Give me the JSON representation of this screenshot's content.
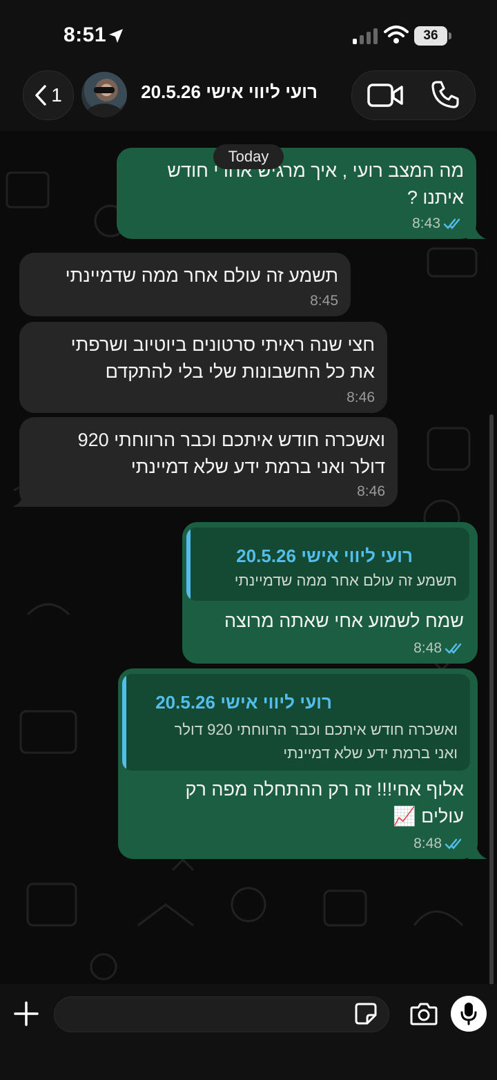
{
  "status_bar": {
    "time": "8:51",
    "battery": "36"
  },
  "header": {
    "back_count": "1",
    "contact_name": "רועי ליווי אישי 20.5.26"
  },
  "date_divider": "Today",
  "messages": [
    {
      "dir": "out",
      "text": "מה המצב רועי , איך מרגיש אחרי חודש\nאיתנו ?",
      "time": "8:43"
    },
    {
      "dir": "in",
      "text": "תשמע זה עולם אחר ממה שדמיינתי",
      "time": "8:45"
    },
    {
      "dir": "in",
      "text": "חצי שנה ראיתי סרטונים ביוטיוב ושרפתי\nאת כל החשבונות שלי בלי להתקדם",
      "time": "8:46"
    },
    {
      "dir": "in",
      "text": "ואשכרה חודש איתכם וכבר הרווחתי 920\nדולר  ואני ברמת ידע שלא דמיינתי",
      "time": "8:46"
    },
    {
      "dir": "out",
      "quote_name": "רועי ליווי אישי 20.5.26",
      "quote_text": "תשמע זה עולם אחר ממה שדמיינתי",
      "text": "שמח לשמוע אחי שאתה מרוצה",
      "time": "8:48"
    },
    {
      "dir": "out",
      "quote_name": "רועי ליווי אישי 20.5.26",
      "quote_text": "ואשכרה חודש איתכם וכבר הרווחתי 920 דולר\nואני ברמת ידע שלא דמיינתי",
      "text": "אלוף אחי!!! זה רק ההתחלה מפה רק\nעולים 📈",
      "time": "8:48"
    }
  ],
  "composer": {
    "placeholder": ""
  },
  "colors": {
    "outgoing": "#1c5e41",
    "incoming": "#262626",
    "quote_accent": "#53bdeb",
    "read_ticks": "#53bdeb"
  },
  "icons": [
    "location-arrow-icon",
    "signal-icon",
    "wifi-icon",
    "battery-icon",
    "chevron-left-icon",
    "video-icon",
    "phone-icon",
    "plus-icon",
    "sticker-icon",
    "camera-icon",
    "microphone-icon",
    "double-check-icon"
  ]
}
